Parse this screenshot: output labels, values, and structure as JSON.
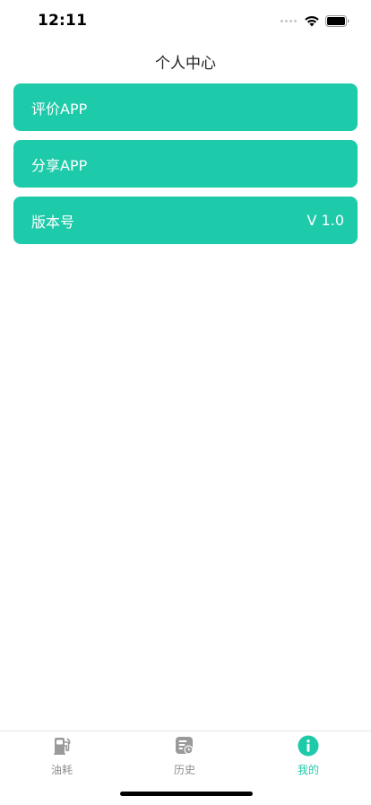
{
  "status_bar": {
    "time": "12:11"
  },
  "nav": {
    "title": "个人中心"
  },
  "menu": {
    "items": [
      {
        "label": "评价APP",
        "value": ""
      },
      {
        "label": "分享APP",
        "value": ""
      },
      {
        "label": "版本号",
        "value": "V 1.0"
      }
    ]
  },
  "tabs": {
    "items": [
      {
        "label": "油耗",
        "icon": "fuel-pump-icon",
        "active": false
      },
      {
        "label": "历史",
        "icon": "history-list-icon",
        "active": false
      },
      {
        "label": "我的",
        "icon": "info-icon",
        "active": true
      }
    ]
  },
  "colors": {
    "accent": "#1dcaa9",
    "tab_inactive": "#8e8e8e",
    "background": "#ffffff"
  }
}
